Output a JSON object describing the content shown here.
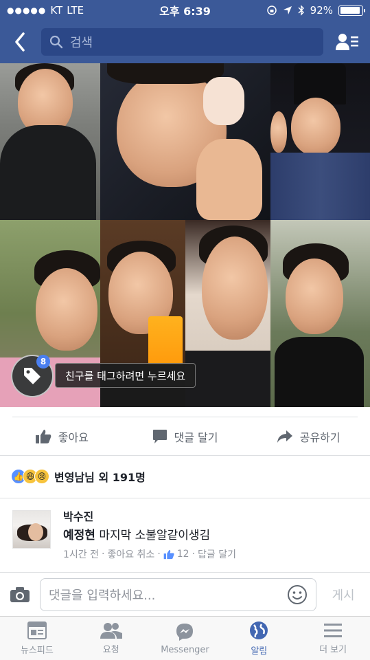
{
  "status_bar": {
    "carrier": "KT",
    "network": "LTE",
    "time": "오후 6:39",
    "battery": "92%",
    "battery_level": 0.92
  },
  "navbar": {
    "search_placeholder": "검색"
  },
  "photo": {
    "tag_count": "8",
    "tag_tooltip": "친구를 태그하려면 누르세요"
  },
  "actions": {
    "like": "좋아요",
    "comment": "댓글 달기",
    "share": "공유하기"
  },
  "reactions": {
    "summary": "변영남님 외 191명"
  },
  "comment": {
    "author": "박수진",
    "mention": "예정현",
    "text": " 마지막 소불알같이생김",
    "time": "1시간 전",
    "unlike": "좋아요 취소",
    "like_count": "12",
    "reply": "답글 달기"
  },
  "composer": {
    "placeholder": "댓글을 입력하세요...",
    "post_label": "게시"
  },
  "tabbar": {
    "items": [
      {
        "label": "뉴스피드"
      },
      {
        "label": "요청"
      },
      {
        "label": "Messenger"
      },
      {
        "label": "알림"
      },
      {
        "label": "더 보기"
      }
    ]
  },
  "colors": {
    "brand": "#3b5998",
    "active_tab": "#4267b2",
    "secondary_text": "#90949c"
  }
}
